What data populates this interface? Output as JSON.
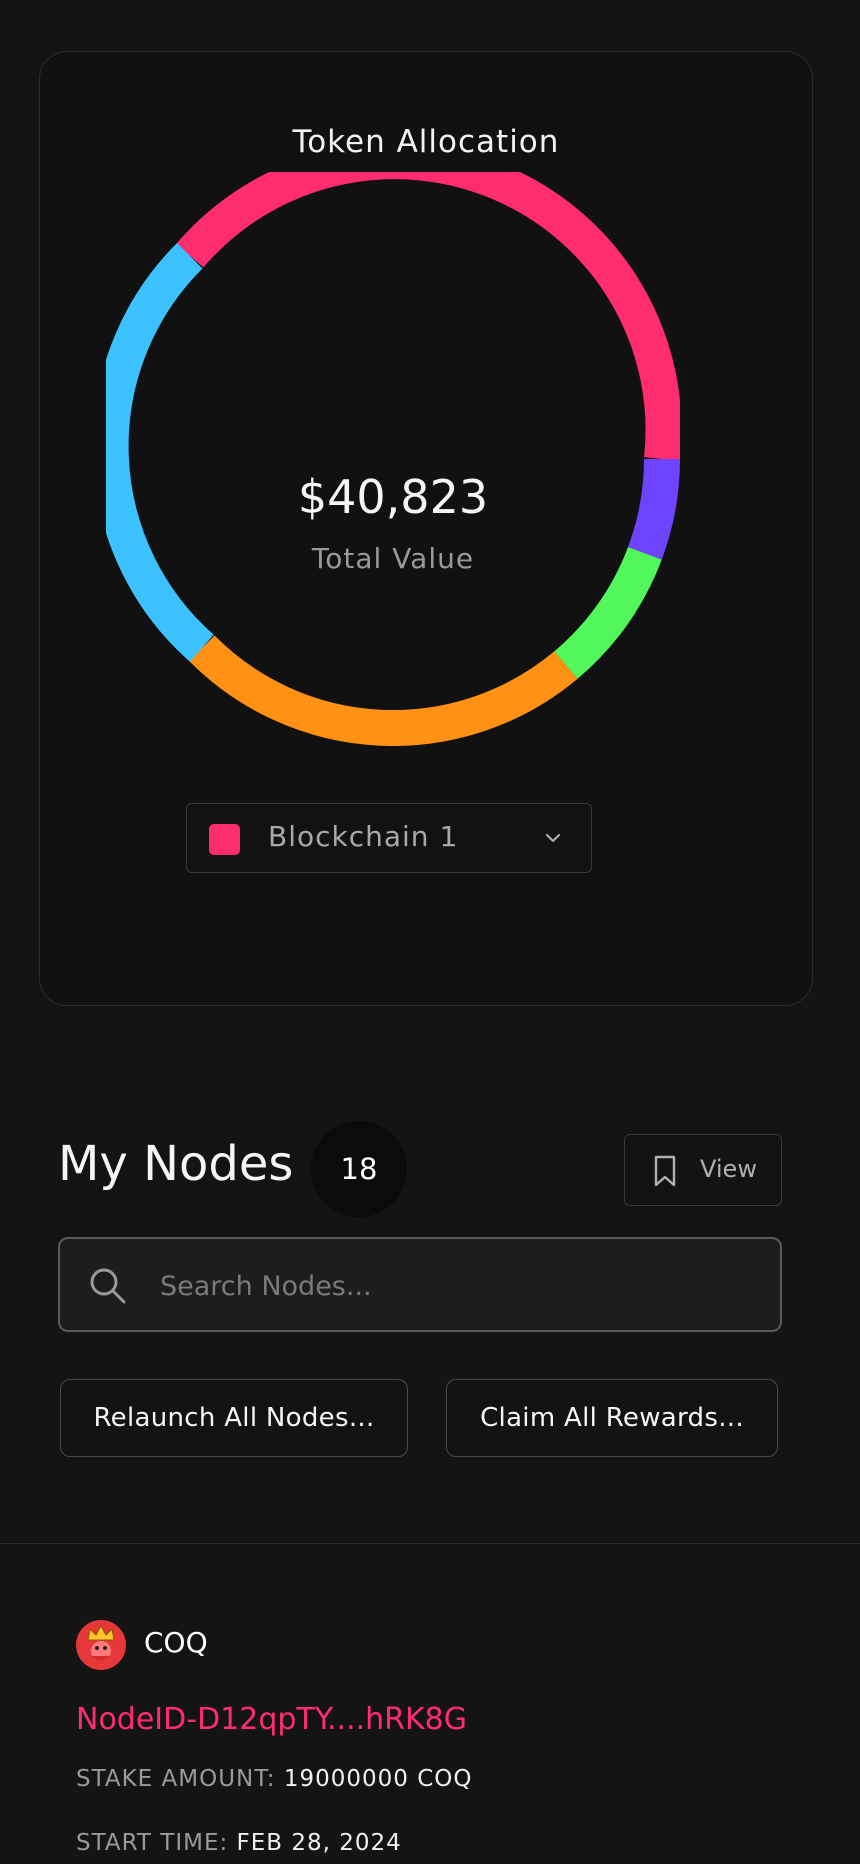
{
  "allocation": {
    "title": "Token Allocation",
    "total_value": "$40,823",
    "total_label": "Total Value",
    "colors": {
      "pink": "#ff2d6f",
      "purple": "#6e44ff",
      "green": "#52f75c",
      "orange": "#ff9214",
      "blue": "#3cc2ff"
    },
    "selected_chain": {
      "label": "Blockchain 1",
      "swatch_color": "#ff2d6f"
    }
  },
  "nodes": {
    "title": "My Nodes",
    "count": "18",
    "view_label": "View",
    "search_placeholder": "Search Nodes...",
    "relaunch_label": "Relaunch All Nodes...",
    "claim_label": "Claim All Rewards..."
  },
  "node_item": {
    "coin": "COQ",
    "node_id": "NodeID-D12qpTY....hRK8G",
    "stake_key": "STAKE AMOUNT:",
    "stake_value": "19000000 COQ",
    "start_key": "START TIME:",
    "start_value": "FEB 28, 2024"
  }
}
